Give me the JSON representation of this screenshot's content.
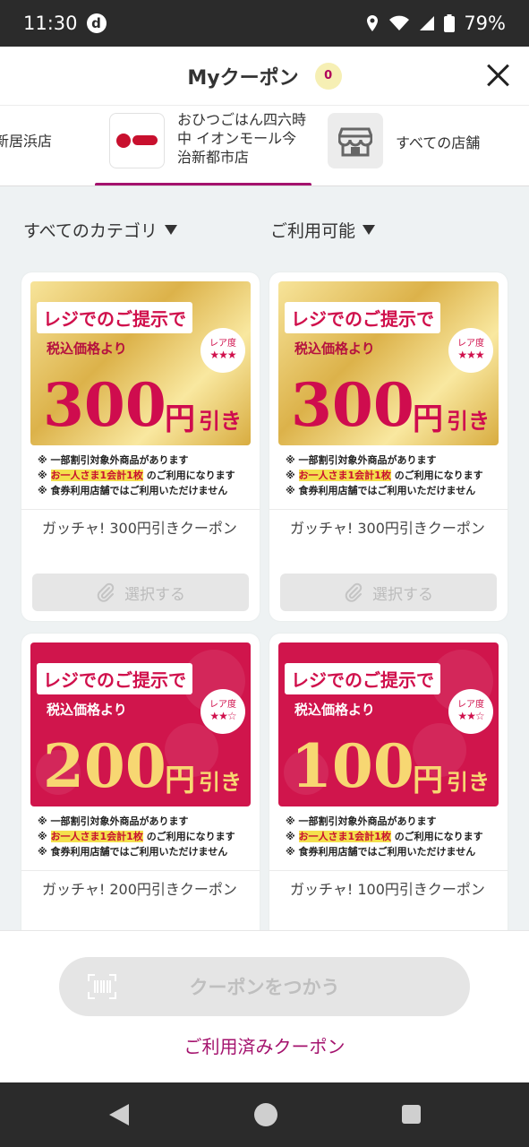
{
  "status_bar": {
    "time": "11:30",
    "carrier_icon": "d",
    "battery": "79%"
  },
  "header": {
    "title": "Myクーポン",
    "count": "0"
  },
  "stores": {
    "prev_tab": "新居浜店",
    "active_tab": "おひつごはん四六時中 イオンモール今治新都市店",
    "all_tab": "すべての店舗"
  },
  "filters": {
    "category": "すべてのカテゴリ",
    "availability": "ご利用可能"
  },
  "coupons": [
    {
      "theme": "gold",
      "banner_label": "レジでのご提示で",
      "tax_text": "税込価格より",
      "rarity_label": "レア度",
      "rarity_stars": "★★★",
      "price": "300",
      "yen": "円",
      "hiki": "引き",
      "note1": "※ 一部割引対象外商品があります",
      "note2_highlight": "お一人さま1会計1枚",
      "note2_suffix": "のご利用になります",
      "note3": "※ 食券利用店舗ではご利用いただけません",
      "title": "ガッチャ! 300円引きクーポン",
      "select_label": "選択する"
    },
    {
      "theme": "gold",
      "banner_label": "レジでのご提示で",
      "tax_text": "税込価格より",
      "rarity_label": "レア度",
      "rarity_stars": "★★★",
      "price": "300",
      "yen": "円",
      "hiki": "引き",
      "note1": "※ 一部割引対象外商品があります",
      "note2_highlight": "お一人さま1会計1枚",
      "note2_suffix": "のご利用になります",
      "note3": "※ 食券利用店舗ではご利用いただけません",
      "title": "ガッチャ! 300円引きクーポン",
      "select_label": "選択する"
    },
    {
      "theme": "pink",
      "banner_label": "レジでのご提示で",
      "tax_text": "税込価格より",
      "rarity_label": "レア度",
      "rarity_stars": "★★☆",
      "price": "200",
      "yen": "円",
      "hiki": "引き",
      "note1": "※ 一部割引対象外商品があります",
      "note2_highlight": "お一人さま1会計1枚",
      "note2_suffix": "のご利用になります",
      "note3": "※ 食券利用店舗ではご利用いただけません",
      "title": "ガッチャ! 200円引きクーポン"
    },
    {
      "theme": "pink",
      "banner_label": "レジでのご提示で",
      "tax_text": "税込価格より",
      "rarity_label": "レア度",
      "rarity_stars": "★★☆",
      "price": "100",
      "yen": "円",
      "hiki": "引き",
      "note1": "※ 一部割引対象外商品があります",
      "note2_highlight": "お一人さま1会計1枚",
      "note2_suffix": "のご利用になります",
      "note3": "※ 食券利用店舗ではご利用いただけません",
      "title": "ガッチャ! 100円引きクーポン"
    }
  ],
  "bottom": {
    "use_button": "クーポンをつかう",
    "used_link": "ご利用済みクーポン"
  },
  "colors": {
    "accent": "#a4126d",
    "coupon_red": "#d0154c",
    "gold": "#dcb24a"
  }
}
